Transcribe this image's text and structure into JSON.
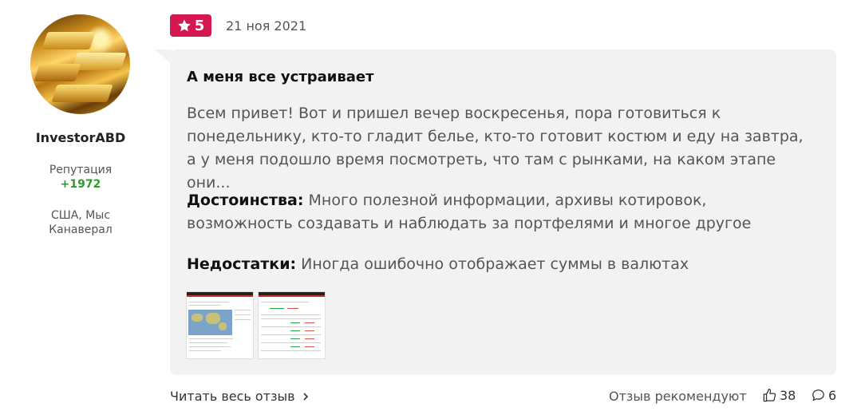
{
  "author": {
    "username": "InvestorABD",
    "reputation_label": "Репутация",
    "reputation_value": "+1972",
    "location": "США, Мыс Канаверал"
  },
  "review": {
    "rating": "5",
    "date": "21 ноя 2021",
    "title": "А меня все устраивает",
    "body": "Всем привет! Вот и пришел вечер воскресенья, пора готовиться к понедельнику, кто-то гладит белье, кто-то готовит костюм и еду на завтра, а у меня подошло время посмотреть, что там с рынками, на каком этапе они...",
    "pros_label": "Достоинства:",
    "pros_text": " Много полезной информации, архивы котировок, возможность создавать и наблюдать за портфелями и многое другое",
    "cons_label": "Недостатки:",
    "cons_text": " Иногда ошибочно отображает суммы в валютах"
  },
  "footer": {
    "read_full": "Читать весь отзыв",
    "recommend_label": "Отзыв рекомендуют",
    "likes": "38",
    "comments": "6"
  },
  "colors": {
    "badge": "#d4174f",
    "reputation": "#2a9d2a",
    "card_bg": "#f2f2f2"
  }
}
